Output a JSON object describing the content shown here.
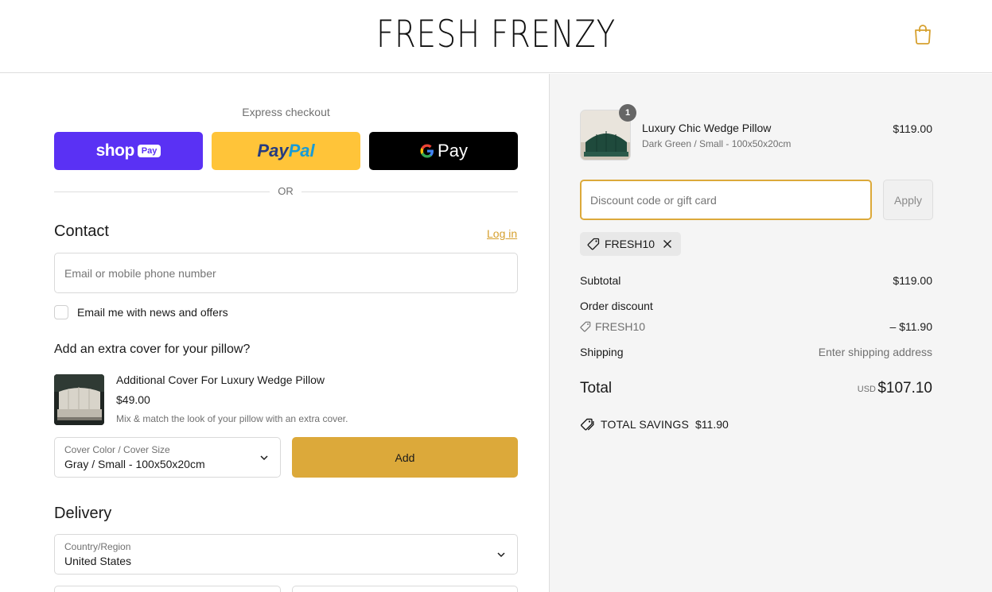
{
  "brand": {
    "name": "FRESH FRENZY",
    "accent": "#dca93a"
  },
  "header": {
    "cart_icon": "shopping-bag-icon"
  },
  "express": {
    "title": "Express checkout",
    "shop": {
      "word": "shop",
      "badge": "Pay"
    },
    "paypal": {
      "part1": "Pay",
      "part2": "Pal"
    },
    "gpay": {
      "g": "G",
      "word": "Pay"
    },
    "or": "OR"
  },
  "contact": {
    "title": "Contact",
    "login": "Log in",
    "email_placeholder": "Email or mobile phone number",
    "newsletter_label": "Email me with news and offers"
  },
  "upsell": {
    "title": "Add an extra cover for your pillow?",
    "name": "Additional Cover For Luxury Wedge Pillow",
    "price": "$49.00",
    "description": "Mix & match the look of your pillow with an extra cover.",
    "option_label": "Cover Color / Cover Size",
    "option_value": "Gray / Small - 100x50x20cm",
    "add_label": "Add"
  },
  "delivery": {
    "title": "Delivery",
    "country_label": "Country/Region",
    "country_value": "United States"
  },
  "order": {
    "product_name": "Luxury Chic Wedge Pillow",
    "product_variant": "Dark Green / Small - 100x50x20cm",
    "product_price": "$119.00",
    "quantity": "1"
  },
  "discount": {
    "placeholder": "Discount code or gift card",
    "apply_label": "Apply",
    "applied_code": "FRESH10"
  },
  "summary": {
    "subtotal_label": "Subtotal",
    "subtotal_value": "$119.00",
    "order_discount_label": "Order discount",
    "discount_code": "FRESH10",
    "discount_value": "– $11.90",
    "shipping_label": "Shipping",
    "shipping_value": "Enter shipping address",
    "total_label": "Total",
    "currency": "USD",
    "total_value": "$107.10",
    "savings_label": "TOTAL SAVINGS",
    "savings_value": "$11.90"
  }
}
